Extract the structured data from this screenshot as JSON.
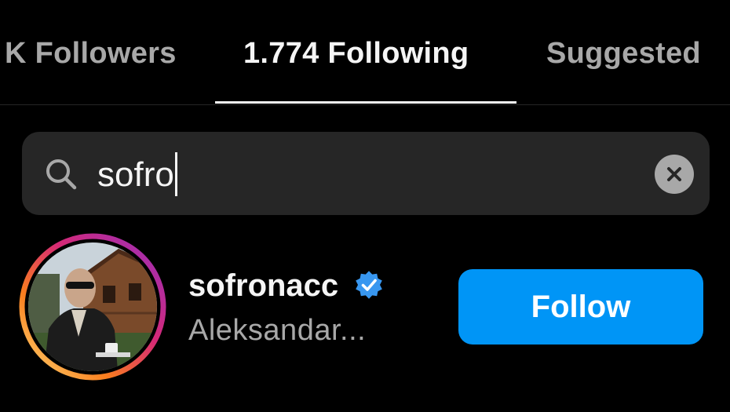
{
  "tabs": [
    {
      "label": "K Followers",
      "active": false
    },
    {
      "label": "1.774 Following",
      "active": true
    },
    {
      "label": "Suggested",
      "active": false
    }
  ],
  "search": {
    "value": "sofro",
    "icon": "search-icon",
    "clear_icon": "close-icon"
  },
  "result": {
    "username": "sofronacc",
    "verified": true,
    "full_name": "Aleksandar...",
    "follow_label": "Follow",
    "avatar_has_story_ring": true
  },
  "colors": {
    "background": "#000000",
    "primary_text": "#f5f5f5",
    "secondary_text": "#a8a8a8",
    "search_background": "#262626",
    "follow_button": "#0095f6",
    "verified_badge": "#3897f0"
  }
}
